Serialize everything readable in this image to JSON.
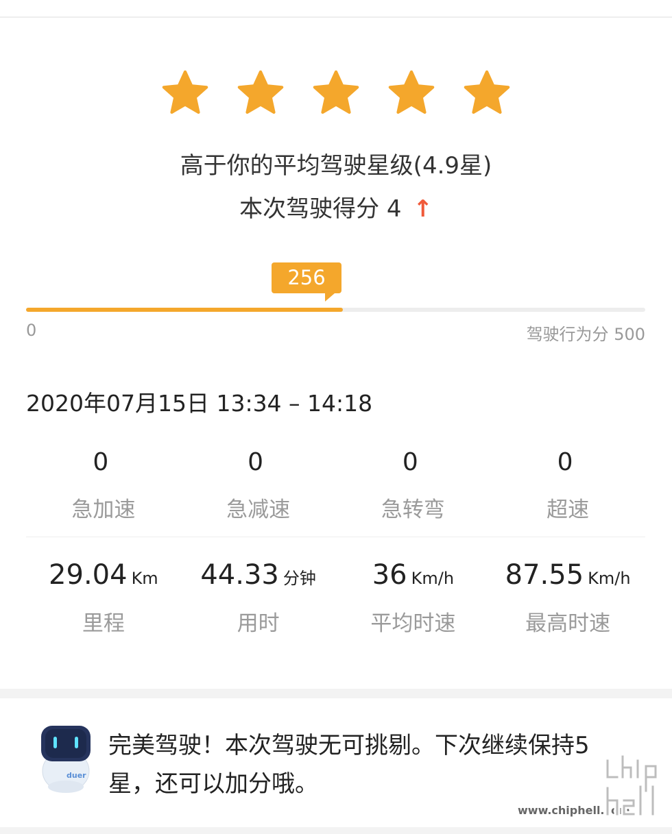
{
  "rating": {
    "stars_filled": 5,
    "stars_total": 5,
    "star_color": "#f4a72c",
    "summary_text": "高于你的平均驾驶星级(4.9星)",
    "score_label": "本次驾驶得分",
    "score_value": "4",
    "score_trend_icon": "arrow-up-icon",
    "score_trend_symbol": "↑",
    "trend_color": "#f05a3a"
  },
  "behavior_score": {
    "value": "256",
    "value_number": 256,
    "min_label": "0",
    "max_label": "驾驶行为分 500",
    "max_number": 500,
    "fill_color": "#f4a72c",
    "track_color": "#ededed"
  },
  "trip": {
    "date_range": "2020年07月15日 13:34 – 14:18"
  },
  "events": [
    {
      "value": "0",
      "label": "急加速"
    },
    {
      "value": "0",
      "label": "急减速"
    },
    {
      "value": "0",
      "label": "急转弯"
    },
    {
      "value": "0",
      "label": "超速"
    }
  ],
  "stats": [
    {
      "value": "29.04",
      "unit": "Km",
      "label": "里程"
    },
    {
      "value": "44.33",
      "unit": "分钟",
      "label": "用时"
    },
    {
      "value": "36",
      "unit": "Km/h",
      "label": "平均时速"
    },
    {
      "value": "87.55",
      "unit": "Km/h",
      "label": "最高时速"
    }
  ],
  "assistant": {
    "avatar_icon": "duer-robot-icon",
    "avatar_text": "duer",
    "message": "完美驾驶！本次驾驶无可挑剔。下次继续保持5星，还可以加分哦。"
  },
  "watermark": {
    "url_text": "www.chiphell.com",
    "logo_icon": "chiphell-logo-icon"
  }
}
